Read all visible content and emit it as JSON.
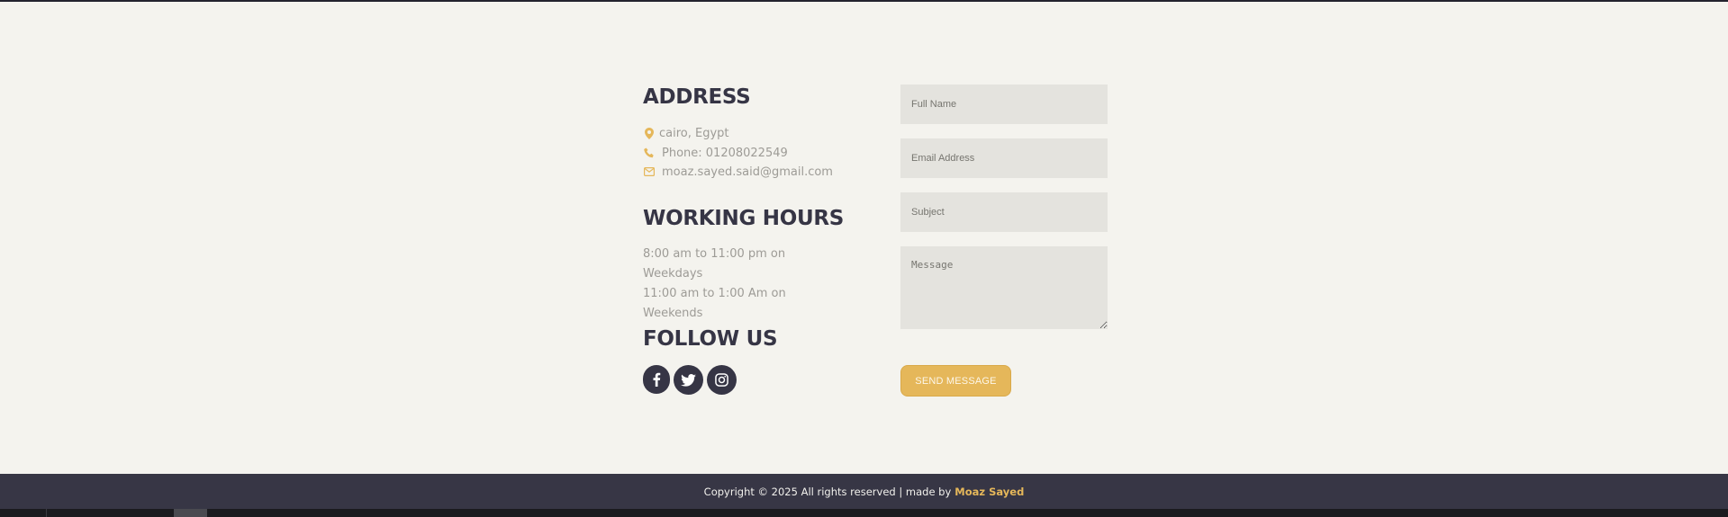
{
  "address": {
    "title": "ADDRESS",
    "location": "cairo, Egypt",
    "phone": "Phone: 01208022549",
    "email": "moaz.sayed.said@gmail.com"
  },
  "working_hours": {
    "title": "WORKING HOURS",
    "line1": "8:00 am to 11:00 pm on Weekdays",
    "line2": "11:00 am to 1:00 Am on Weekends"
  },
  "follow": {
    "title": "FOLLOW US",
    "icons": [
      "facebook-icon",
      "twitter-icon",
      "instagram-icon"
    ]
  },
  "form": {
    "full_name_placeholder": "Full Name",
    "email_placeholder": "Email Address",
    "subject_placeholder": "Subject",
    "message_placeholder": "Message",
    "submit_label": "SEND MESSAGE"
  },
  "footer": {
    "copyright": "Copyright © 2025 All rights reserved | made by",
    "author": "Moaz Sayed"
  },
  "colors": {
    "accent": "#e5b75a",
    "dark": "#363545",
    "background": "#f4f3ee",
    "field": "#e4e3de"
  }
}
